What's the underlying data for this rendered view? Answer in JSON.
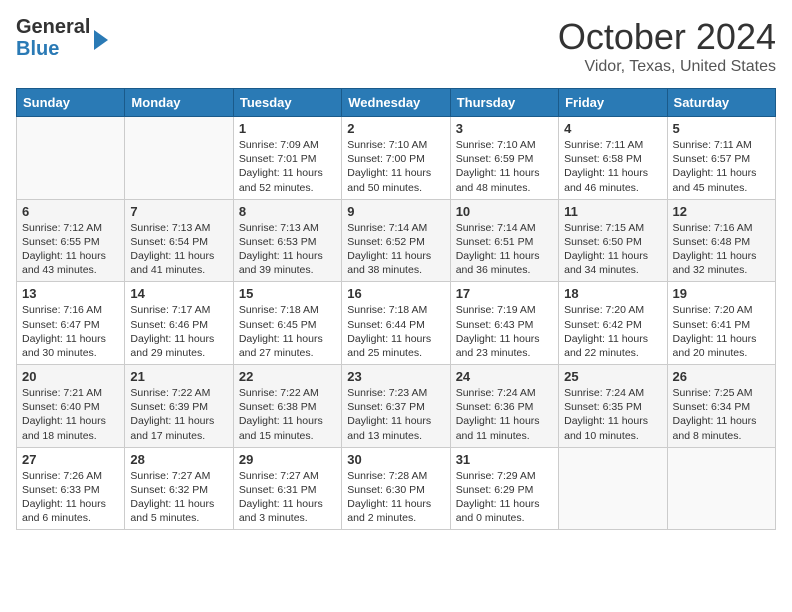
{
  "header": {
    "logo_line1": "General",
    "logo_line2": "Blue",
    "month_title": "October 2024",
    "location": "Vidor, Texas, United States"
  },
  "days_of_week": [
    "Sunday",
    "Monday",
    "Tuesday",
    "Wednesday",
    "Thursday",
    "Friday",
    "Saturday"
  ],
  "weeks": [
    [
      {
        "day": "",
        "info": ""
      },
      {
        "day": "",
        "info": ""
      },
      {
        "day": "1",
        "info": "Sunrise: 7:09 AM\nSunset: 7:01 PM\nDaylight: 11 hours and 52 minutes."
      },
      {
        "day": "2",
        "info": "Sunrise: 7:10 AM\nSunset: 7:00 PM\nDaylight: 11 hours and 50 minutes."
      },
      {
        "day": "3",
        "info": "Sunrise: 7:10 AM\nSunset: 6:59 PM\nDaylight: 11 hours and 48 minutes."
      },
      {
        "day": "4",
        "info": "Sunrise: 7:11 AM\nSunset: 6:58 PM\nDaylight: 11 hours and 46 minutes."
      },
      {
        "day": "5",
        "info": "Sunrise: 7:11 AM\nSunset: 6:57 PM\nDaylight: 11 hours and 45 minutes."
      }
    ],
    [
      {
        "day": "6",
        "info": "Sunrise: 7:12 AM\nSunset: 6:55 PM\nDaylight: 11 hours and 43 minutes."
      },
      {
        "day": "7",
        "info": "Sunrise: 7:13 AM\nSunset: 6:54 PM\nDaylight: 11 hours and 41 minutes."
      },
      {
        "day": "8",
        "info": "Sunrise: 7:13 AM\nSunset: 6:53 PM\nDaylight: 11 hours and 39 minutes."
      },
      {
        "day": "9",
        "info": "Sunrise: 7:14 AM\nSunset: 6:52 PM\nDaylight: 11 hours and 38 minutes."
      },
      {
        "day": "10",
        "info": "Sunrise: 7:14 AM\nSunset: 6:51 PM\nDaylight: 11 hours and 36 minutes."
      },
      {
        "day": "11",
        "info": "Sunrise: 7:15 AM\nSunset: 6:50 PM\nDaylight: 11 hours and 34 minutes."
      },
      {
        "day": "12",
        "info": "Sunrise: 7:16 AM\nSunset: 6:48 PM\nDaylight: 11 hours and 32 minutes."
      }
    ],
    [
      {
        "day": "13",
        "info": "Sunrise: 7:16 AM\nSunset: 6:47 PM\nDaylight: 11 hours and 30 minutes."
      },
      {
        "day": "14",
        "info": "Sunrise: 7:17 AM\nSunset: 6:46 PM\nDaylight: 11 hours and 29 minutes."
      },
      {
        "day": "15",
        "info": "Sunrise: 7:18 AM\nSunset: 6:45 PM\nDaylight: 11 hours and 27 minutes."
      },
      {
        "day": "16",
        "info": "Sunrise: 7:18 AM\nSunset: 6:44 PM\nDaylight: 11 hours and 25 minutes."
      },
      {
        "day": "17",
        "info": "Sunrise: 7:19 AM\nSunset: 6:43 PM\nDaylight: 11 hours and 23 minutes."
      },
      {
        "day": "18",
        "info": "Sunrise: 7:20 AM\nSunset: 6:42 PM\nDaylight: 11 hours and 22 minutes."
      },
      {
        "day": "19",
        "info": "Sunrise: 7:20 AM\nSunset: 6:41 PM\nDaylight: 11 hours and 20 minutes."
      }
    ],
    [
      {
        "day": "20",
        "info": "Sunrise: 7:21 AM\nSunset: 6:40 PM\nDaylight: 11 hours and 18 minutes."
      },
      {
        "day": "21",
        "info": "Sunrise: 7:22 AM\nSunset: 6:39 PM\nDaylight: 11 hours and 17 minutes."
      },
      {
        "day": "22",
        "info": "Sunrise: 7:22 AM\nSunset: 6:38 PM\nDaylight: 11 hours and 15 minutes."
      },
      {
        "day": "23",
        "info": "Sunrise: 7:23 AM\nSunset: 6:37 PM\nDaylight: 11 hours and 13 minutes."
      },
      {
        "day": "24",
        "info": "Sunrise: 7:24 AM\nSunset: 6:36 PM\nDaylight: 11 hours and 11 minutes."
      },
      {
        "day": "25",
        "info": "Sunrise: 7:24 AM\nSunset: 6:35 PM\nDaylight: 11 hours and 10 minutes."
      },
      {
        "day": "26",
        "info": "Sunrise: 7:25 AM\nSunset: 6:34 PM\nDaylight: 11 hours and 8 minutes."
      }
    ],
    [
      {
        "day": "27",
        "info": "Sunrise: 7:26 AM\nSunset: 6:33 PM\nDaylight: 11 hours and 6 minutes."
      },
      {
        "day": "28",
        "info": "Sunrise: 7:27 AM\nSunset: 6:32 PM\nDaylight: 11 hours and 5 minutes."
      },
      {
        "day": "29",
        "info": "Sunrise: 7:27 AM\nSunset: 6:31 PM\nDaylight: 11 hours and 3 minutes."
      },
      {
        "day": "30",
        "info": "Sunrise: 7:28 AM\nSunset: 6:30 PM\nDaylight: 11 hours and 2 minutes."
      },
      {
        "day": "31",
        "info": "Sunrise: 7:29 AM\nSunset: 6:29 PM\nDaylight: 11 hours and 0 minutes."
      },
      {
        "day": "",
        "info": ""
      },
      {
        "day": "",
        "info": ""
      }
    ]
  ]
}
